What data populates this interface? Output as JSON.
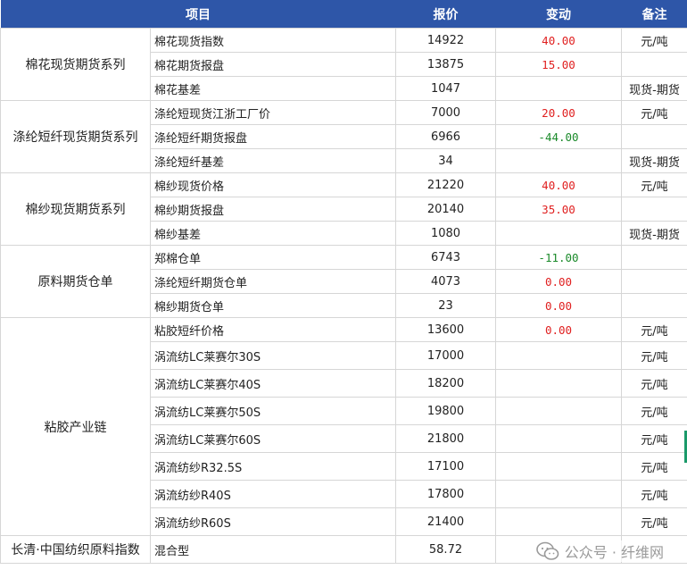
{
  "header": {
    "item": "项目",
    "price": "报价",
    "change": "变动",
    "note": "备注"
  },
  "groups": [
    {
      "name": "棉花现货期货系列",
      "rows": [
        {
          "item": "棉花现货指数",
          "price": "14922",
          "change": "40.00",
          "dir": "up",
          "note": "元/吨"
        },
        {
          "item": "棉花期货报盘",
          "price": "13875",
          "change": "15.00",
          "dir": "up",
          "note": ""
        },
        {
          "item": "棉花基差",
          "price": "1047",
          "change": "",
          "dir": "",
          "note": "现货-期货"
        }
      ]
    },
    {
      "name": "涤纶短纤现货期货系列",
      "rows": [
        {
          "item": "涤纶短现货江浙工厂价",
          "price": "7000",
          "change": "20.00",
          "dir": "up",
          "note": "元/吨"
        },
        {
          "item": "涤纶短纤期货报盘",
          "price": "6966",
          "change": "-44.00",
          "dir": "down",
          "note": ""
        },
        {
          "item": "涤纶短纤基差",
          "price": "34",
          "change": "",
          "dir": "",
          "note": "现货-期货"
        }
      ]
    },
    {
      "name": "棉纱现货期货系列",
      "rows": [
        {
          "item": "棉纱现货价格",
          "price": "21220",
          "change": "40.00",
          "dir": "up",
          "note": "元/吨"
        },
        {
          "item": "棉纱期货报盘",
          "price": "20140",
          "change": "35.00",
          "dir": "up",
          "note": ""
        },
        {
          "item": "棉纱基差",
          "price": "1080",
          "change": "",
          "dir": "",
          "note": "现货-期货"
        }
      ]
    },
    {
      "name": "原料期货仓单",
      "rows": [
        {
          "item": "郑棉仓单",
          "price": "6743",
          "change": "-11.00",
          "dir": "down",
          "note": ""
        },
        {
          "item": "涤纶短纤期货仓单",
          "price": "4073",
          "change": "0.00",
          "dir": "flat",
          "note": ""
        },
        {
          "item": "棉纱期货仓单",
          "price": "23",
          "change": "0.00",
          "dir": "flat",
          "note": ""
        }
      ]
    },
    {
      "name": "粘胶产业链",
      "rows": [
        {
          "item": "粘胶短纤价格",
          "price": "13600",
          "change": "0.00",
          "dir": "flat",
          "note": "元/吨"
        },
        {
          "item": "涡流纺LC莱赛尔30S",
          "price": "17000",
          "change": "",
          "dir": "",
          "note": "元/吨"
        },
        {
          "item": "涡流纺LC莱赛尔40S",
          "price": "18200",
          "change": "",
          "dir": "",
          "note": "元/吨"
        },
        {
          "item": "涡流纺LC莱赛尔50S",
          "price": "19800",
          "change": "",
          "dir": "",
          "note": "元/吨"
        },
        {
          "item": "涡流纺LC莱赛尔60S",
          "price": "21800",
          "change": "",
          "dir": "",
          "note": "元/吨"
        },
        {
          "item": "涡流纺纱R32.5S",
          "price": "17100",
          "change": "",
          "dir": "",
          "note": "元/吨"
        },
        {
          "item": "涡流纺纱R40S",
          "price": "17800",
          "change": "",
          "dir": "",
          "note": "元/吨"
        },
        {
          "item": "涡流纺纱R60S",
          "price": "21400",
          "change": "",
          "dir": "",
          "note": "元/吨"
        }
      ]
    }
  ],
  "footer_row": {
    "name": "长清·中国纺织原料指数",
    "item": "混合型",
    "price": "58.72",
    "change": "",
    "note": ""
  },
  "watermark": {
    "text": "公众号 · 纤维网",
    "icon": "wechat-icon"
  },
  "colors": {
    "header_bg": "#2e56a8",
    "up": "#e02020",
    "down": "#1a8a2a"
  }
}
